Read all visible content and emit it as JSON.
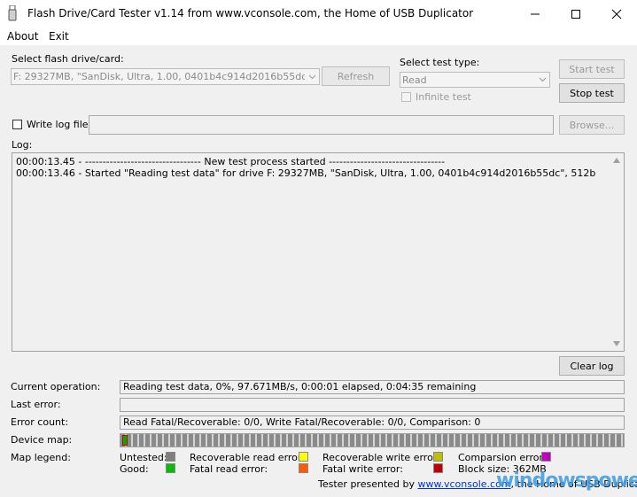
{
  "window": {
    "title": "Flash Drive/Card Tester v1.14 from www.vconsole.com, the Home of USB Duplicator",
    "icon": "usb-stick-icon"
  },
  "menu": {
    "items": [
      "About",
      "Exit"
    ]
  },
  "drive": {
    "label": "Select flash drive/card:",
    "selected": "F: 29327MB, \"SanDisk, Ultra, 1.00, 0401b4c914d2016b55dc\", 512b",
    "refresh_label": "Refresh"
  },
  "test_type": {
    "label": "Select test type:",
    "selected": "Read",
    "infinite_label": "Infinite test"
  },
  "buttons": {
    "start": "Start test",
    "stop": "Stop test",
    "browse": "Browse...",
    "clear_log": "Clear log"
  },
  "log_file": {
    "label": "Write log file",
    "value": ""
  },
  "log": {
    "label": "Log:",
    "lines": [
      "00:00:13.45 - --------------------------------- New test process started ---------------------------------",
      "00:00:13.46 - Started \"Reading test data\" for drive F: 29327MB, \"SanDisk, Ultra, 1.00, 0401b4c914d2016b55dc\", 512b"
    ]
  },
  "status": {
    "current_operation_label": "Current operation:",
    "current_operation": "Reading test data, 0%, 97.671MB/s, 0:00:01 elapsed, 0:04:35 remaining",
    "last_error_label": "Last error:",
    "last_error": "",
    "error_count_label": "Error count:",
    "error_count": "Read Fatal/Recoverable: 0/0, Write Fatal/Recoverable: 0/0, Comparison: 0",
    "device_map_label": "Device map:",
    "device_map_progress": 0
  },
  "legend": {
    "label": "Map legend:",
    "untested": {
      "label": "Untested:",
      "color": "#808080"
    },
    "good": {
      "label": "Good:",
      "color": "#00c000"
    },
    "recoverable_read": {
      "label": "Recoverable read error:",
      "color": "#ffff00"
    },
    "fatal_read": {
      "label": "Fatal read error:",
      "color": "#ff5a00"
    },
    "recoverable_write": {
      "label": "Recoverable write error:",
      "color": "#c0c000"
    },
    "fatal_write": {
      "label": "Fatal write error:",
      "color": "#c00000"
    },
    "comparison": {
      "label": "Comparsion error:",
      "color": "#c000c0"
    },
    "block_size": "Block size: 362MB"
  },
  "footer": {
    "prefix": "Tester presented by",
    "link": "www.vconsole.com",
    "suffix": ", the Home of USB Duplicator"
  },
  "watermark": {
    "text": "windowspower"
  }
}
